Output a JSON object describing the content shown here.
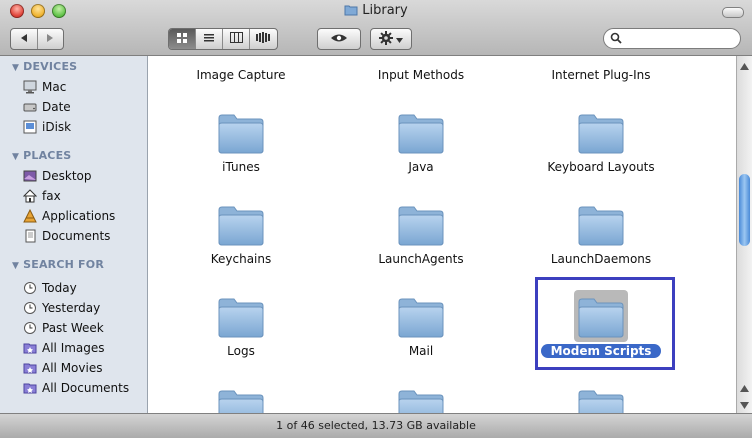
{
  "window": {
    "title": "Library"
  },
  "toolbar": {
    "back_icon": "back-arrow-icon",
    "forward_icon": "forward-arrow-icon",
    "views": [
      "icon-view-icon",
      "list-view-icon",
      "column-view-icon",
      "coverflow-view-icon"
    ],
    "active_view": "icon",
    "quicklook_icon": "eye-icon",
    "action_icon": "gear-icon",
    "search": {
      "placeholder": "",
      "value": ""
    }
  },
  "sidebar": {
    "devices": {
      "header": "DEVICES",
      "items": [
        {
          "label": "Mac",
          "icon": "mac-icon"
        },
        {
          "label": "Date",
          "icon": "disk-icon"
        },
        {
          "label": "iDisk",
          "icon": "idisk-icon"
        }
      ]
    },
    "places": {
      "header": "PLACES",
      "items": [
        {
          "label": "Desktop",
          "icon": "desktop-icon"
        },
        {
          "label": "fax",
          "icon": "home-icon"
        },
        {
          "label": "Applications",
          "icon": "applications-icon"
        },
        {
          "label": "Documents",
          "icon": "documents-icon"
        }
      ]
    },
    "search_for": {
      "header": "SEARCH FOR",
      "items": [
        {
          "label": "Today",
          "icon": "clock-icon"
        },
        {
          "label": "Yesterday",
          "icon": "clock-icon"
        },
        {
          "label": "Past Week",
          "icon": "clock-icon"
        },
        {
          "label": "All Images",
          "icon": "smart-folder-icon"
        },
        {
          "label": "All Movies",
          "icon": "smart-folder-icon"
        },
        {
          "label": "All Documents",
          "icon": "smart-folder-icon"
        }
      ]
    }
  },
  "main": {
    "rows": [
      [
        "Image Capture",
        "Input Methods",
        "Internet Plug-Ins"
      ],
      [
        "iTunes",
        "Java",
        "Keyboard Layouts"
      ],
      [
        "Keychains",
        "LaunchAgents",
        "LaunchDaemons"
      ],
      [
        "Logs",
        "Mail",
        "Modem Scripts"
      ]
    ],
    "selected": "Modem Scripts"
  },
  "status": {
    "text": "1 of 46 selected, 13.73 GB available"
  },
  "colors": {
    "selection": "#3a68c8",
    "highlight_box": "#3c3fbf",
    "sidebar_bg": "#dfe5ed",
    "folder": "#8fb6dc"
  }
}
